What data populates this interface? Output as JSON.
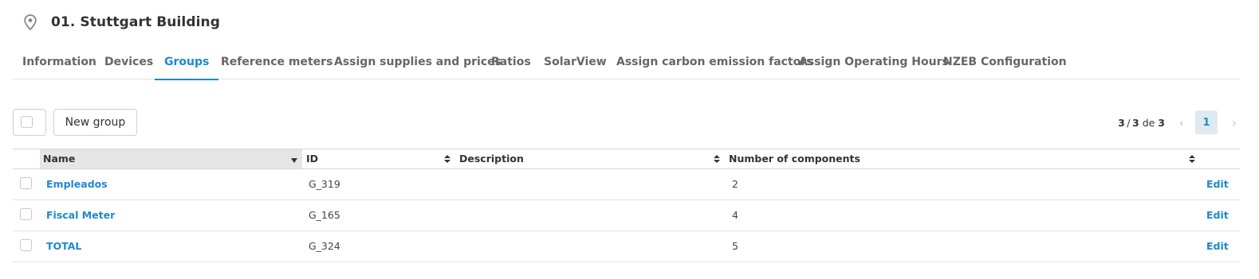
{
  "header": {
    "title": "01. Stuttgart Building",
    "icon": "location-pin-icon"
  },
  "tabs": [
    {
      "label": "Information"
    },
    {
      "label": "Devices"
    },
    {
      "label": "Groups",
      "active": true
    },
    {
      "label": "Reference meters"
    },
    {
      "label": "Assign supplies and prices"
    },
    {
      "label": "Ratios"
    },
    {
      "label": "SolarView"
    },
    {
      "label": "Assign carbon emission factors"
    },
    {
      "label": "Assign Operating Hours"
    },
    {
      "label": "NZEB Configuration"
    }
  ],
  "toolbar": {
    "new_group_label": "New group"
  },
  "pagination": {
    "shown": "3",
    "total_shown": "3",
    "of_label": "de",
    "total": "3",
    "current_page": "1"
  },
  "table": {
    "columns": [
      "Name",
      "ID",
      "Description",
      "Number of components"
    ],
    "sorted_column": "Name",
    "rows": [
      {
        "name": "Empleados",
        "id": "G_319",
        "description": "",
        "components": "2",
        "action": "Edit"
      },
      {
        "name": "Fiscal Meter",
        "id": "G_165",
        "description": "",
        "components": "4",
        "action": "Edit"
      },
      {
        "name": "TOTAL",
        "id": "G_324",
        "description": "",
        "components": "5",
        "action": "Edit"
      }
    ]
  },
  "colors": {
    "accent": "#1e88d0",
    "text": "#333333",
    "muted": "#666666"
  }
}
